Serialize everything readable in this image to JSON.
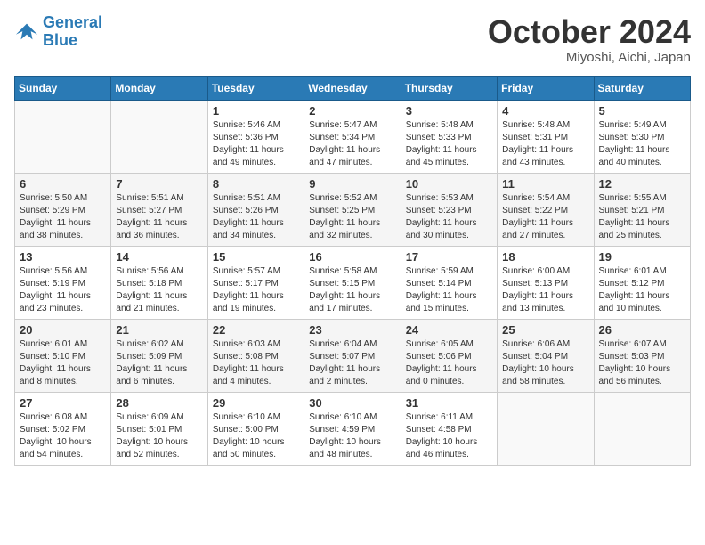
{
  "header": {
    "logo_line1": "General",
    "logo_line2": "Blue",
    "month": "October 2024",
    "location": "Miyoshi, Aichi, Japan"
  },
  "days_of_week": [
    "Sunday",
    "Monday",
    "Tuesday",
    "Wednesday",
    "Thursday",
    "Friday",
    "Saturday"
  ],
  "weeks": [
    [
      {
        "day": "",
        "sunrise": "",
        "sunset": "",
        "daylight": ""
      },
      {
        "day": "",
        "sunrise": "",
        "sunset": "",
        "daylight": ""
      },
      {
        "day": "1",
        "sunrise": "Sunrise: 5:46 AM",
        "sunset": "Sunset: 5:36 PM",
        "daylight": "Daylight: 11 hours and 49 minutes."
      },
      {
        "day": "2",
        "sunrise": "Sunrise: 5:47 AM",
        "sunset": "Sunset: 5:34 PM",
        "daylight": "Daylight: 11 hours and 47 minutes."
      },
      {
        "day": "3",
        "sunrise": "Sunrise: 5:48 AM",
        "sunset": "Sunset: 5:33 PM",
        "daylight": "Daylight: 11 hours and 45 minutes."
      },
      {
        "day": "4",
        "sunrise": "Sunrise: 5:48 AM",
        "sunset": "Sunset: 5:31 PM",
        "daylight": "Daylight: 11 hours and 43 minutes."
      },
      {
        "day": "5",
        "sunrise": "Sunrise: 5:49 AM",
        "sunset": "Sunset: 5:30 PM",
        "daylight": "Daylight: 11 hours and 40 minutes."
      }
    ],
    [
      {
        "day": "6",
        "sunrise": "Sunrise: 5:50 AM",
        "sunset": "Sunset: 5:29 PM",
        "daylight": "Daylight: 11 hours and 38 minutes."
      },
      {
        "day": "7",
        "sunrise": "Sunrise: 5:51 AM",
        "sunset": "Sunset: 5:27 PM",
        "daylight": "Daylight: 11 hours and 36 minutes."
      },
      {
        "day": "8",
        "sunrise": "Sunrise: 5:51 AM",
        "sunset": "Sunset: 5:26 PM",
        "daylight": "Daylight: 11 hours and 34 minutes."
      },
      {
        "day": "9",
        "sunrise": "Sunrise: 5:52 AM",
        "sunset": "Sunset: 5:25 PM",
        "daylight": "Daylight: 11 hours and 32 minutes."
      },
      {
        "day": "10",
        "sunrise": "Sunrise: 5:53 AM",
        "sunset": "Sunset: 5:23 PM",
        "daylight": "Daylight: 11 hours and 30 minutes."
      },
      {
        "day": "11",
        "sunrise": "Sunrise: 5:54 AM",
        "sunset": "Sunset: 5:22 PM",
        "daylight": "Daylight: 11 hours and 27 minutes."
      },
      {
        "day": "12",
        "sunrise": "Sunrise: 5:55 AM",
        "sunset": "Sunset: 5:21 PM",
        "daylight": "Daylight: 11 hours and 25 minutes."
      }
    ],
    [
      {
        "day": "13",
        "sunrise": "Sunrise: 5:56 AM",
        "sunset": "Sunset: 5:19 PM",
        "daylight": "Daylight: 11 hours and 23 minutes."
      },
      {
        "day": "14",
        "sunrise": "Sunrise: 5:56 AM",
        "sunset": "Sunset: 5:18 PM",
        "daylight": "Daylight: 11 hours and 21 minutes."
      },
      {
        "day": "15",
        "sunrise": "Sunrise: 5:57 AM",
        "sunset": "Sunset: 5:17 PM",
        "daylight": "Daylight: 11 hours and 19 minutes."
      },
      {
        "day": "16",
        "sunrise": "Sunrise: 5:58 AM",
        "sunset": "Sunset: 5:15 PM",
        "daylight": "Daylight: 11 hours and 17 minutes."
      },
      {
        "day": "17",
        "sunrise": "Sunrise: 5:59 AM",
        "sunset": "Sunset: 5:14 PM",
        "daylight": "Daylight: 11 hours and 15 minutes."
      },
      {
        "day": "18",
        "sunrise": "Sunrise: 6:00 AM",
        "sunset": "Sunset: 5:13 PM",
        "daylight": "Daylight: 11 hours and 13 minutes."
      },
      {
        "day": "19",
        "sunrise": "Sunrise: 6:01 AM",
        "sunset": "Sunset: 5:12 PM",
        "daylight": "Daylight: 11 hours and 10 minutes."
      }
    ],
    [
      {
        "day": "20",
        "sunrise": "Sunrise: 6:01 AM",
        "sunset": "Sunset: 5:10 PM",
        "daylight": "Daylight: 11 hours and 8 minutes."
      },
      {
        "day": "21",
        "sunrise": "Sunrise: 6:02 AM",
        "sunset": "Sunset: 5:09 PM",
        "daylight": "Daylight: 11 hours and 6 minutes."
      },
      {
        "day": "22",
        "sunrise": "Sunrise: 6:03 AM",
        "sunset": "Sunset: 5:08 PM",
        "daylight": "Daylight: 11 hours and 4 minutes."
      },
      {
        "day": "23",
        "sunrise": "Sunrise: 6:04 AM",
        "sunset": "Sunset: 5:07 PM",
        "daylight": "Daylight: 11 hours and 2 minutes."
      },
      {
        "day": "24",
        "sunrise": "Sunrise: 6:05 AM",
        "sunset": "Sunset: 5:06 PM",
        "daylight": "Daylight: 11 hours and 0 minutes."
      },
      {
        "day": "25",
        "sunrise": "Sunrise: 6:06 AM",
        "sunset": "Sunset: 5:04 PM",
        "daylight": "Daylight: 10 hours and 58 minutes."
      },
      {
        "day": "26",
        "sunrise": "Sunrise: 6:07 AM",
        "sunset": "Sunset: 5:03 PM",
        "daylight": "Daylight: 10 hours and 56 minutes."
      }
    ],
    [
      {
        "day": "27",
        "sunrise": "Sunrise: 6:08 AM",
        "sunset": "Sunset: 5:02 PM",
        "daylight": "Daylight: 10 hours and 54 minutes."
      },
      {
        "day": "28",
        "sunrise": "Sunrise: 6:09 AM",
        "sunset": "Sunset: 5:01 PM",
        "daylight": "Daylight: 10 hours and 52 minutes."
      },
      {
        "day": "29",
        "sunrise": "Sunrise: 6:10 AM",
        "sunset": "Sunset: 5:00 PM",
        "daylight": "Daylight: 10 hours and 50 minutes."
      },
      {
        "day": "30",
        "sunrise": "Sunrise: 6:10 AM",
        "sunset": "Sunset: 4:59 PM",
        "daylight": "Daylight: 10 hours and 48 minutes."
      },
      {
        "day": "31",
        "sunrise": "Sunrise: 6:11 AM",
        "sunset": "Sunset: 4:58 PM",
        "daylight": "Daylight: 10 hours and 46 minutes."
      },
      {
        "day": "",
        "sunrise": "",
        "sunset": "",
        "daylight": ""
      },
      {
        "day": "",
        "sunrise": "",
        "sunset": "",
        "daylight": ""
      }
    ]
  ]
}
